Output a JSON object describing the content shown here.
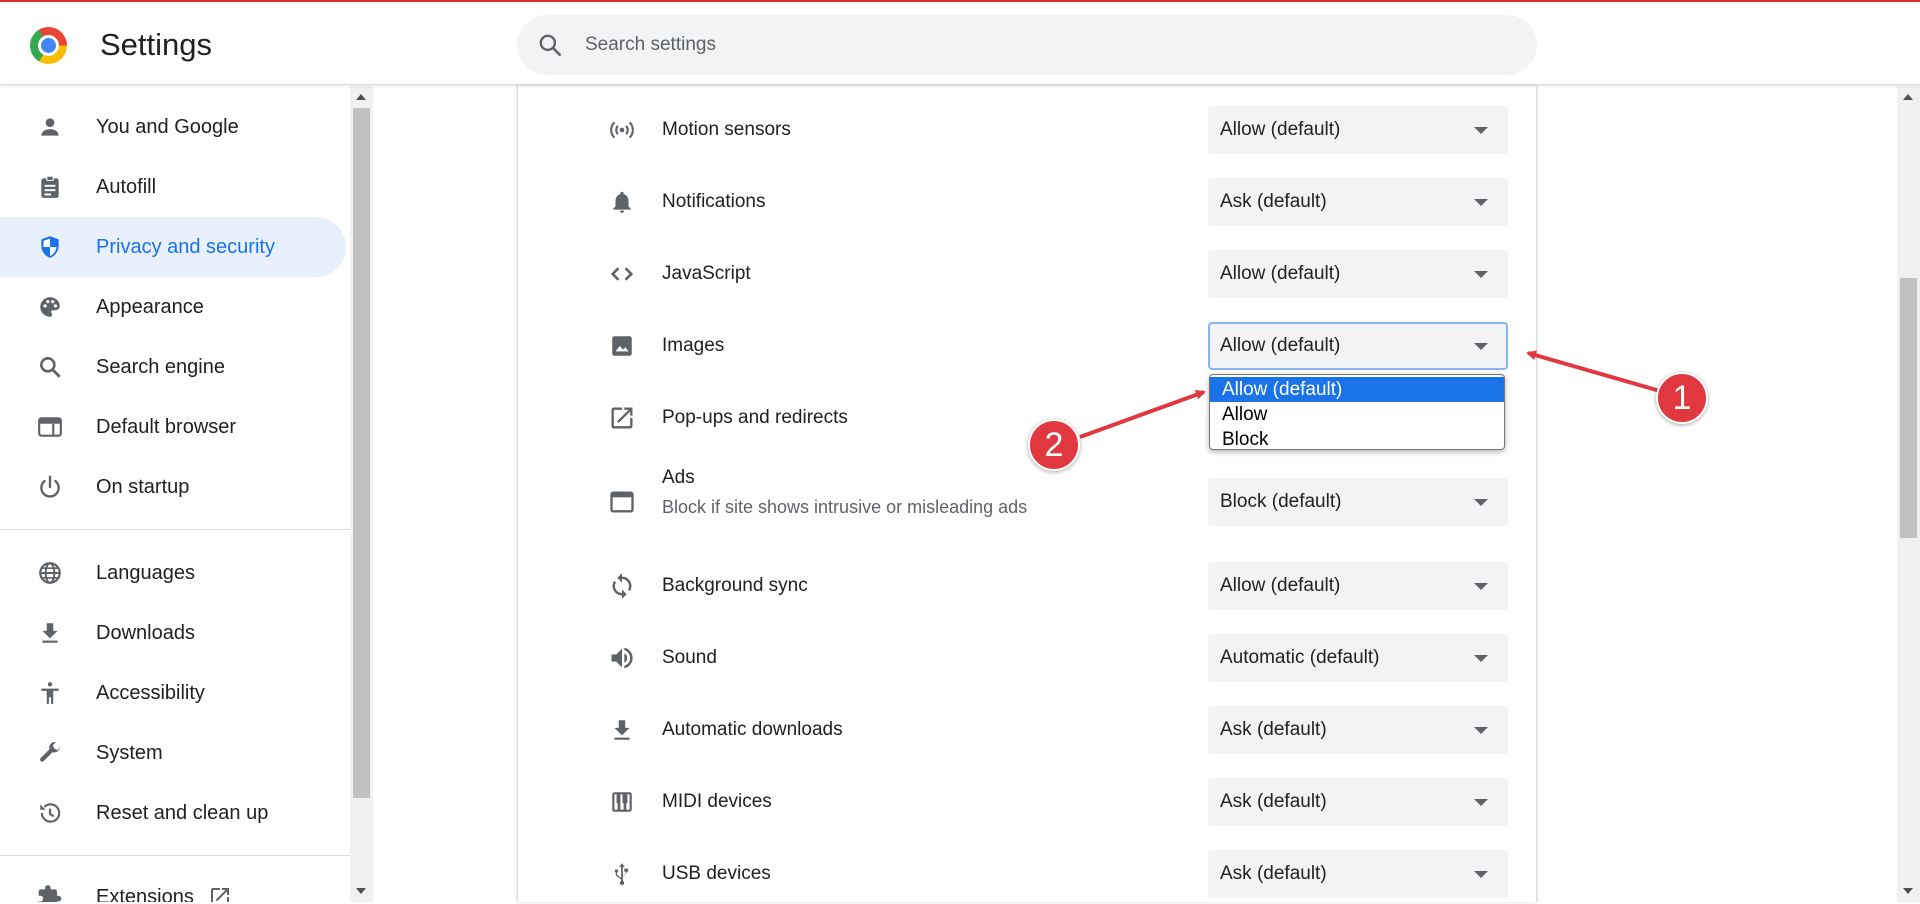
{
  "header": {
    "title": "Settings",
    "search_placeholder": "Search settings"
  },
  "sidebar": {
    "items": [
      {
        "label": "You and Google",
        "icon": "person-icon"
      },
      {
        "label": "Autofill",
        "icon": "clipboard-icon"
      },
      {
        "label": "Privacy and security",
        "icon": "shield-icon",
        "active": true
      },
      {
        "label": "Appearance",
        "icon": "palette-icon"
      },
      {
        "label": "Search engine",
        "icon": "search-icon"
      },
      {
        "label": "Default browser",
        "icon": "browser-window-icon"
      },
      {
        "label": "On startup",
        "icon": "power-icon"
      }
    ],
    "items2": [
      {
        "label": "Languages",
        "icon": "globe-icon"
      },
      {
        "label": "Downloads",
        "icon": "download-icon"
      },
      {
        "label": "Accessibility",
        "icon": "accessibility-icon"
      },
      {
        "label": "System",
        "icon": "wrench-icon"
      },
      {
        "label": "Reset and clean up",
        "icon": "history-icon"
      }
    ],
    "extensions": {
      "label": "Extensions",
      "icon": "puzzle-icon"
    }
  },
  "permissions": [
    {
      "label": "Motion sensors",
      "value": "Allow (default)",
      "icon": "sensors-icon"
    },
    {
      "label": "Notifications",
      "value": "Ask (default)",
      "icon": "bell-icon"
    },
    {
      "label": "JavaScript",
      "value": "Allow (default)",
      "icon": "code-icon"
    },
    {
      "label": "Images",
      "value": "Allow (default)",
      "icon": "image-icon"
    },
    {
      "label": "Pop-ups and redirects",
      "value": "",
      "icon": "open-in-new-icon"
    },
    {
      "label": "Ads",
      "sublabel": "Block if site shows intrusive or misleading ads",
      "value": "Block (default)",
      "icon": "ads-window-icon"
    },
    {
      "label": "Background sync",
      "value": "Allow (default)",
      "icon": "sync-icon"
    },
    {
      "label": "Sound",
      "value": "Automatic (default)",
      "icon": "speaker-icon"
    },
    {
      "label": "Automatic downloads",
      "value": "Ask (default)",
      "icon": "download-icon"
    },
    {
      "label": "MIDI devices",
      "value": "Ask (default)",
      "icon": "piano-icon"
    },
    {
      "label": "USB devices",
      "value": "Ask (default)",
      "icon": "usb-icon"
    }
  ],
  "dropdown": {
    "options": [
      "Allow (default)",
      "Allow",
      "Block"
    ],
    "selected": "Allow (default)"
  },
  "annotations": {
    "badge1": "1",
    "badge2": "2",
    "color": "#e0383e"
  }
}
